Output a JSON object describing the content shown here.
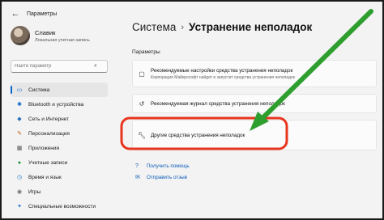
{
  "window": {
    "title": "Параметры"
  },
  "profile": {
    "name": "Славик",
    "account": "Локальная учетная запись"
  },
  "search": {
    "placeholder": "Найти параметр"
  },
  "nav": [
    {
      "label": "Система",
      "icon": "system-icon",
      "color": "#0a64c8",
      "active": true
    },
    {
      "label": "Bluetooth и устройства",
      "icon": "bluetooth-icon",
      "color": "#0a64c8"
    },
    {
      "label": "Сеть и Интернет",
      "icon": "wifi-icon",
      "color": "#2b6fb8"
    },
    {
      "label": "Персонализация",
      "icon": "brush-icon",
      "color": "#c2590f"
    },
    {
      "label": "Приложения",
      "icon": "apps-icon",
      "color": "#555555"
    },
    {
      "label": "Учетные записи",
      "icon": "person-icon",
      "color": "#1f8f3a"
    },
    {
      "label": "Время и язык",
      "icon": "globe-clock-icon",
      "color": "#1c72c6"
    },
    {
      "label": "Игры",
      "icon": "gamepad-icon",
      "color": "#6b6b6b"
    },
    {
      "label": "Специальные возможности",
      "icon": "accessibility-icon",
      "color": "#1c72c6"
    }
  ],
  "breadcrumb": {
    "parent": "Система",
    "current": "Устранение неполадок"
  },
  "section_label": "Параметры",
  "cards": [
    {
      "title": "Рекомендуемые настройки средства устранения неполадок",
      "subtitle": "Корпорация Майкрософт найдет и запустит средства устранения неполадок"
    },
    {
      "title": "Рекомендуемая журнал средства устранения неполадок"
    },
    {
      "title": "Другие средства устранения неполадок"
    }
  ],
  "links": [
    {
      "label": "Получить помощь",
      "icon": "help-icon"
    },
    {
      "label": "Отправить отзыв",
      "icon": "feedback-icon"
    }
  ],
  "colors": {
    "accent": "#0a64c8",
    "arrow": "#2e9e2e",
    "highlight": "#e8351e"
  }
}
